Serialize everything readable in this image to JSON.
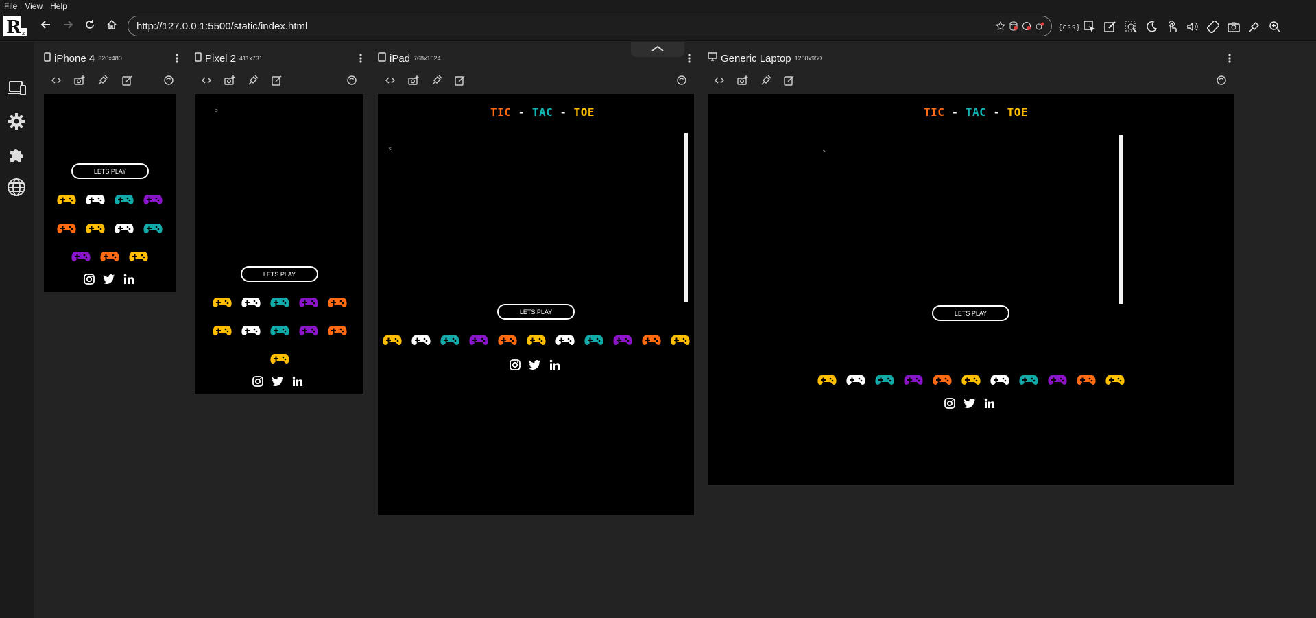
{
  "menu": {
    "file": "File",
    "view": "View",
    "help": "Help"
  },
  "address": {
    "url": "http://127.0.0.1:5500/static/index.html"
  },
  "toolbar": {
    "css_chip": "{css}"
  },
  "app": {
    "game_title": {
      "part1": "TIC",
      "part2": "TAC",
      "part3": "TOE",
      "sep": "-"
    },
    "play_label": "LETS PLAY",
    "tiny_char": "s",
    "colors": {
      "tic": "#ff6a13",
      "tac": "#12b5b5",
      "toe": "#ffbf00",
      "yellow": "#ffbf00",
      "white": "#ffffff",
      "teal": "#12a9a9",
      "purple": "#8a14c8",
      "orange": "#ff6a13"
    }
  },
  "devices": [
    {
      "name": "iPhone 4",
      "size": "320x480"
    },
    {
      "name": "Pixel 2",
      "size": "411x731"
    },
    {
      "name": "iPad",
      "size": "768x1024"
    },
    {
      "name": "Generic Laptop",
      "size": "1280x950"
    }
  ],
  "icons": {
    "sidebar": [
      "devices-icon",
      "settings-gear-icon",
      "extensions-puzzle-icon",
      "network-globe-icon"
    ],
    "device_tools": [
      "code-icon",
      "screenshot-icon",
      "devtools-icon",
      "edit-icon",
      "rotate-icon"
    ]
  }
}
